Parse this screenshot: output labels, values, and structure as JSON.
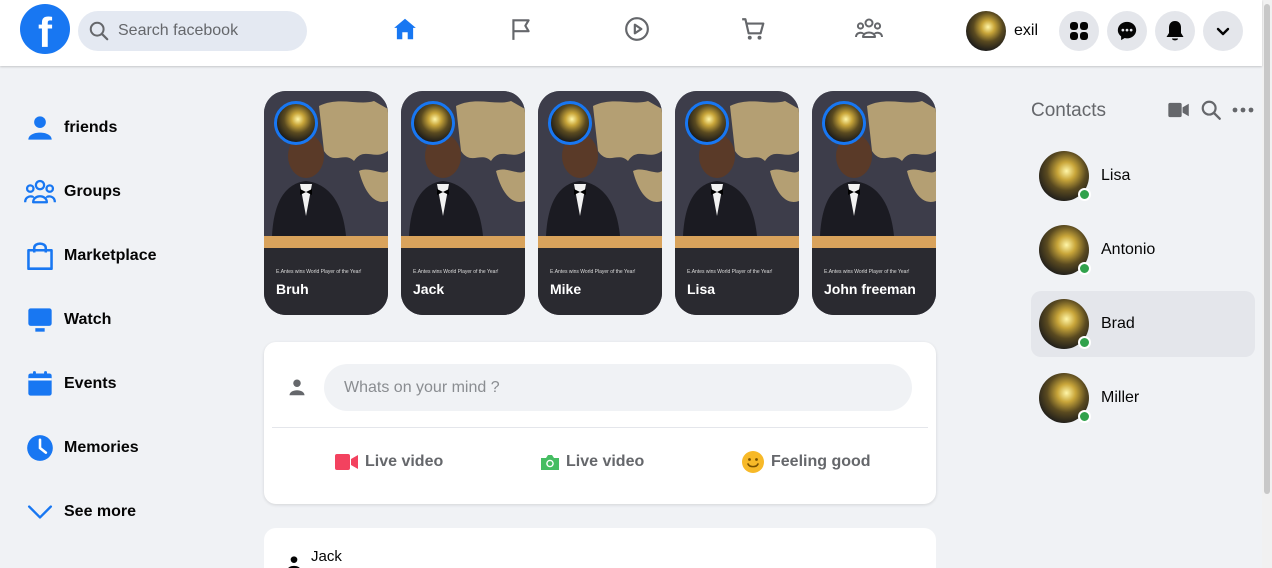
{
  "colors": {
    "brand": "#1877f2",
    "online": "#31a24c",
    "live_red": "#f3425f",
    "photo_green": "#45bd62",
    "feeling_yellow": "#f7b928"
  },
  "header": {
    "logo_letter": "f",
    "search_placeholder": "Search facebook",
    "nav": [
      "home-icon",
      "flag-icon",
      "watch-icon",
      "marketplace-icon",
      "groups-icon"
    ],
    "profile_name": "exil",
    "actions": [
      "menu-icon",
      "messenger-icon",
      "bell-icon",
      "chevron-down-icon"
    ]
  },
  "sidebar": {
    "items": [
      {
        "label": "friends",
        "icon": "friends-icon"
      },
      {
        "label": "Groups",
        "icon": "groups-icon"
      },
      {
        "label": "Marketplace",
        "icon": "marketplace-icon"
      },
      {
        "label": "Watch",
        "icon": "watch-icon"
      },
      {
        "label": "Events",
        "icon": "events-icon"
      },
      {
        "label": "Memories",
        "icon": "clock-icon"
      },
      {
        "label": "See more",
        "icon": "chevron-down-icon"
      }
    ]
  },
  "stories": [
    {
      "name": "Bruh",
      "caption": "E.Antes wins World Player of the Year!"
    },
    {
      "name": "Jack",
      "caption": "E.Antes wins World Player of the Year!"
    },
    {
      "name": "Mike",
      "caption": "E.Antes wins World Player of the Year!"
    },
    {
      "name": "Lisa",
      "caption": "E.Antes wins World Player of the Year!"
    },
    {
      "name": "John freeman",
      "caption": "E.Antes wins World Player of the Year!"
    }
  ],
  "composer": {
    "placeholder": "Whats on your mind ?",
    "actions": [
      {
        "label": "Live video",
        "icon": "video-camera-icon"
      },
      {
        "label": "Live video",
        "icon": "photo-camera-icon"
      },
      {
        "label": "Feeling good",
        "icon": "smiley-icon"
      }
    ]
  },
  "post": {
    "author": "Jack"
  },
  "contacts": {
    "title": "Contacts",
    "items": [
      {
        "name": "Lisa",
        "active": false
      },
      {
        "name": "Antonio",
        "active": false
      },
      {
        "name": "Brad",
        "active": true
      },
      {
        "name": "Miller",
        "active": false
      }
    ]
  }
}
